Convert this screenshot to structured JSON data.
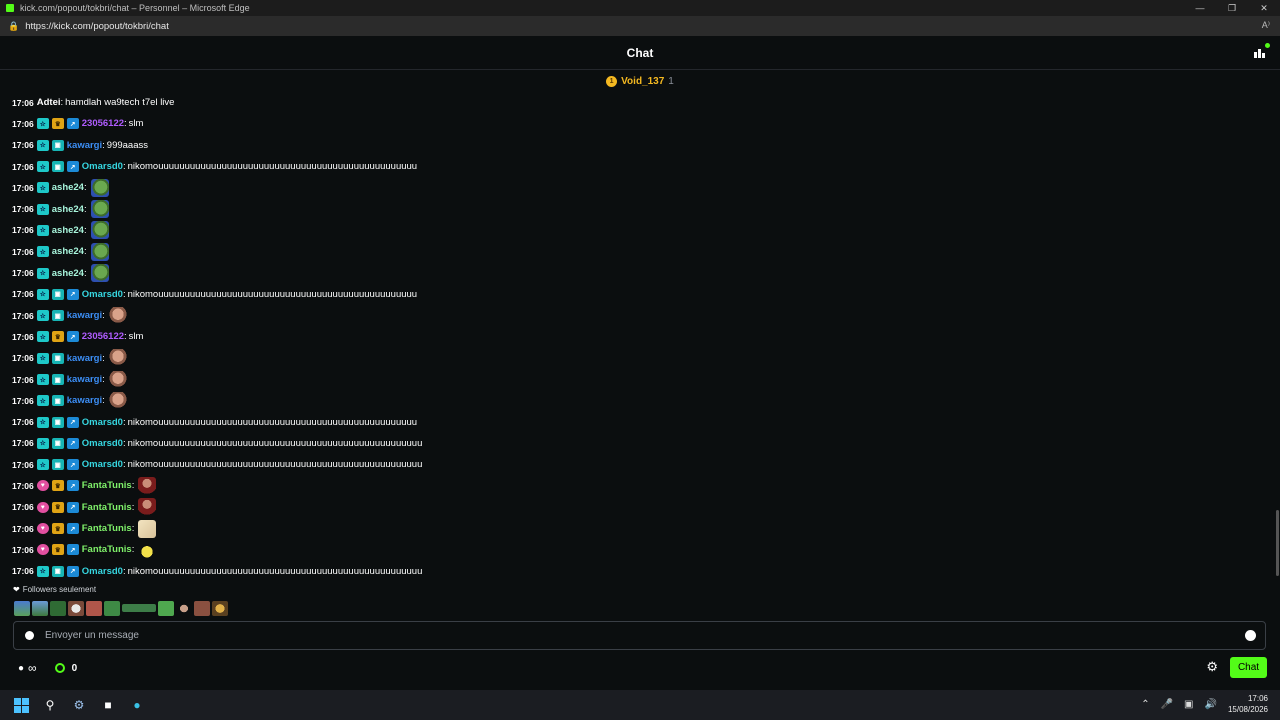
{
  "browser": {
    "window_title": "kick.com/popout/tokbri/chat – Personnel – Microsoft Edge",
    "url": "https://kick.com/popout/tokbri/chat",
    "read_aloud_label": "A⁾"
  },
  "chat": {
    "title": "Chat",
    "pinned_user": {
      "rank": "1",
      "name": "Void_137",
      "count": "1"
    },
    "messages": [
      {
        "time": "17:06",
        "badges": [],
        "user": "Adtei",
        "user_color": "#ffffff",
        "text": "hamdlah wa9tech t7el live",
        "emote": ""
      },
      {
        "time": "17:06",
        "badges": [
          "sub",
          "crown",
          "verified"
        ],
        "user": "23056122",
        "user_color": "#b05cff",
        "text": "slm",
        "emote": ""
      },
      {
        "time": "17:06",
        "badges": [
          "sub",
          "og"
        ],
        "user": "kawargi",
        "user_color": "#3c8ef5",
        "text": "999aaass",
        "emote": ""
      },
      {
        "time": "17:06",
        "badges": [
          "sub",
          "og",
          "verified"
        ],
        "user": "Omarsd0",
        "user_color": "#36d6e0",
        "text": "nikomouuuuuuuuuuuuuuuuuuuuuuuuuuuuuuuuuuuuuuuuuuuuuuuuu",
        "emote": ""
      },
      {
        "time": "17:06",
        "badges": [
          "sub"
        ],
        "user": "ashe24",
        "user_color": "#a8f5dc",
        "text": "",
        "emote": "pepe"
      },
      {
        "time": "17:06",
        "badges": [
          "sub"
        ],
        "user": "ashe24",
        "user_color": "#a8f5dc",
        "text": "",
        "emote": "pepe"
      },
      {
        "time": "17:06",
        "badges": [
          "sub"
        ],
        "user": "ashe24",
        "user_color": "#a8f5dc",
        "text": "",
        "emote": "pepe"
      },
      {
        "time": "17:06",
        "badges": [
          "sub"
        ],
        "user": "ashe24",
        "user_color": "#a8f5dc",
        "text": "",
        "emote": "pepe"
      },
      {
        "time": "17:06",
        "badges": [
          "sub"
        ],
        "user": "ashe24",
        "user_color": "#a8f5dc",
        "text": "",
        "emote": "pepe"
      },
      {
        "time": "17:06",
        "badges": [
          "sub",
          "og",
          "verified"
        ],
        "user": "Omarsd0",
        "user_color": "#36d6e0",
        "text": "nikomouuuuuuuuuuuuuuuuuuuuuuuuuuuuuuuuuuuuuuuuuuuuuuuuu",
        "emote": ""
      },
      {
        "time": "17:06",
        "badges": [
          "sub",
          "og"
        ],
        "user": "kawargi",
        "user_color": "#3c8ef5",
        "text": "",
        "emote": "face"
      },
      {
        "time": "17:06",
        "badges": [
          "sub",
          "crown",
          "verified"
        ],
        "user": "23056122",
        "user_color": "#b05cff",
        "text": "slm",
        "emote": ""
      },
      {
        "time": "17:06",
        "badges": [
          "sub",
          "og"
        ],
        "user": "kawargi",
        "user_color": "#3c8ef5",
        "text": "",
        "emote": "face"
      },
      {
        "time": "17:06",
        "badges": [
          "sub",
          "og"
        ],
        "user": "kawargi",
        "user_color": "#3c8ef5",
        "text": "",
        "emote": "face"
      },
      {
        "time": "17:06",
        "badges": [
          "sub",
          "og"
        ],
        "user": "kawargi",
        "user_color": "#3c8ef5",
        "text": "",
        "emote": "face"
      },
      {
        "time": "17:06",
        "badges": [
          "sub",
          "og",
          "verified"
        ],
        "user": "Omarsd0",
        "user_color": "#36d6e0",
        "text": "nikomouuuuuuuuuuuuuuuuuuuuuuuuuuuuuuuuuuuuuuuuuuuuuuuuu",
        "emote": ""
      },
      {
        "time": "17:06",
        "badges": [
          "sub",
          "og",
          "verified"
        ],
        "user": "Omarsd0",
        "user_color": "#36d6e0",
        "text": "nikomouuuuuuuuuuuuuuuuuuuuuuuuuuuuuuuuuuuuuuuuuuuuuuuuuu",
        "emote": ""
      },
      {
        "time": "17:06",
        "badges": [
          "sub",
          "og",
          "verified"
        ],
        "user": "Omarsd0",
        "user_color": "#36d6e0",
        "text": "nikomouuuuuuuuuuuuuuuuuuuuuuuuuuuuuuuuuuuuuuuuuuuuuuuuuu",
        "emote": ""
      },
      {
        "time": "17:06",
        "badges": [
          "pink",
          "crown",
          "verified"
        ],
        "user": "FantaTunis",
        "user_color": "#7ff06a",
        "text": "",
        "emote": "face2"
      },
      {
        "time": "17:06",
        "badges": [
          "pink",
          "crown",
          "verified"
        ],
        "user": "FantaTunis",
        "user_color": "#7ff06a",
        "text": "",
        "emote": "face2"
      },
      {
        "time": "17:06",
        "badges": [
          "pink",
          "crown",
          "verified"
        ],
        "user": "FantaTunis",
        "user_color": "#7ff06a",
        "text": "",
        "emote": "anime"
      },
      {
        "time": "17:06",
        "badges": [
          "pink",
          "crown",
          "verified"
        ],
        "user": "FantaTunis",
        "user_color": "#7ff06a",
        "text": "",
        "emote": "blob"
      },
      {
        "time": "17:06",
        "badges": [
          "sub",
          "og",
          "verified"
        ],
        "user": "Omarsd0",
        "user_color": "#36d6e0",
        "text": "nikomouuuuuuuuuuuuuuuuuuuuuuuuuuuuuuuuuuuuuuuuuuuuuuuuuu",
        "emote": ""
      }
    ],
    "followers_only_label": "Followers seulement",
    "input_placeholder": "Envoyer un message",
    "points": "0",
    "send_button_label": "Chat"
  },
  "taskbar": {
    "time": "17:06",
    "date": "15/08/2026"
  },
  "colors": {
    "accent": "#53fc18",
    "background": "#0b0e0f"
  }
}
